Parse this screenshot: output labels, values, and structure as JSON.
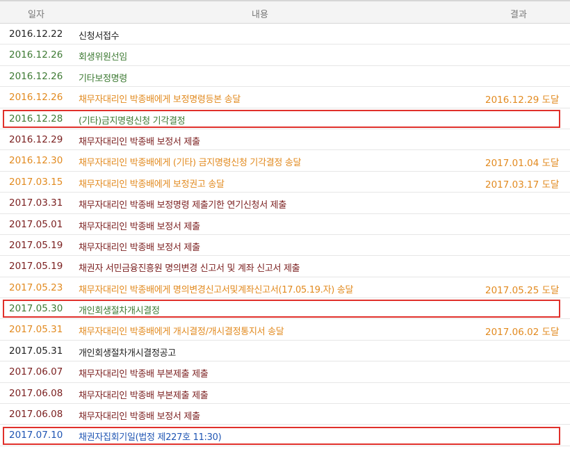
{
  "header": {
    "date": "일자",
    "content": "내용",
    "result": "결과"
  },
  "colors": {
    "black": "#222222",
    "green": "#3d7a33",
    "orange": "#e28a1f",
    "maroon": "#7a1e1e",
    "blue": "#1f55b3",
    "highlight": "#e0302a"
  },
  "rows": [
    {
      "date": "2016.12.22",
      "content": "신청서접수",
      "result": "",
      "color": "black",
      "highlight": false
    },
    {
      "date": "2016.12.26",
      "content": "회생위원선임",
      "result": "",
      "color": "green",
      "highlight": false
    },
    {
      "date": "2016.12.26",
      "content": "기타보정명령",
      "result": "",
      "color": "green",
      "highlight": false
    },
    {
      "date": "2016.12.26",
      "content": "채무자대리인 박종배에게 보정명령등본 송달",
      "result": "2016.12.29 도달",
      "color": "orange",
      "highlight": false
    },
    {
      "date": "2016.12.28",
      "content": "(기타)금지명령신청 기각결정",
      "result": "",
      "color": "green",
      "highlight": true
    },
    {
      "date": "2016.12.29",
      "content": "채무자대리인 박종배 보정서 제출",
      "result": "",
      "color": "maroon",
      "highlight": false
    },
    {
      "date": "2016.12.30",
      "content": "채무자대리인 박종배에게 (기타) 금지명령신청 기각결정 송달",
      "result": "2017.01.04 도달",
      "color": "orange",
      "highlight": false
    },
    {
      "date": "2017.03.15",
      "content": "채무자대리인 박종배에게 보정권고 송달",
      "result": "2017.03.17 도달",
      "color": "orange",
      "highlight": false
    },
    {
      "date": "2017.03.31",
      "content": "채무자대리인 박종배 보정명령 제출기한 연기신청서 제출",
      "result": "",
      "color": "maroon",
      "highlight": false
    },
    {
      "date": "2017.05.01",
      "content": "채무자대리인 박종배 보정서 제출",
      "result": "",
      "color": "maroon",
      "highlight": false
    },
    {
      "date": "2017.05.19",
      "content": "채무자대리인 박종배 보정서 제출",
      "result": "",
      "color": "maroon",
      "highlight": false
    },
    {
      "date": "2017.05.19",
      "content": "채권자 서민금융진흥원 명의변경 신고서 및 계좌 신고서 제출",
      "result": "",
      "color": "maroon",
      "highlight": false
    },
    {
      "date": "2017.05.23",
      "content": "채무자대리인 박종배에게 명의변경신고서및계좌신고서(17.05.19.자) 송달",
      "result": "2017.05.25 도달",
      "color": "orange",
      "highlight": false
    },
    {
      "date": "2017.05.30",
      "content": "개인회생절차개시결정",
      "result": "",
      "color": "green",
      "highlight": true
    },
    {
      "date": "2017.05.31",
      "content": "채무자대리인 박종배에게 개시결정/개시결정통지서 송달",
      "result": "2017.06.02 도달",
      "color": "orange",
      "highlight": false
    },
    {
      "date": "2017.05.31",
      "content": "개인회생절차개시결정공고",
      "result": "",
      "color": "black",
      "highlight": false
    },
    {
      "date": "2017.06.07",
      "content": "채무자대리인 박종배 부본제출 제출",
      "result": "",
      "color": "maroon",
      "highlight": false
    },
    {
      "date": "2017.06.08",
      "content": "채무자대리인 박종배 부본제출 제출",
      "result": "",
      "color": "maroon",
      "highlight": false
    },
    {
      "date": "2017.06.08",
      "content": "채무자대리인 박종배 보정서 제출",
      "result": "",
      "color": "maroon",
      "highlight": false
    },
    {
      "date": "2017.07.10",
      "content": "채권자집회기일(법정 제227호 11:30)",
      "result": "",
      "color": "blue",
      "highlight": true
    }
  ]
}
